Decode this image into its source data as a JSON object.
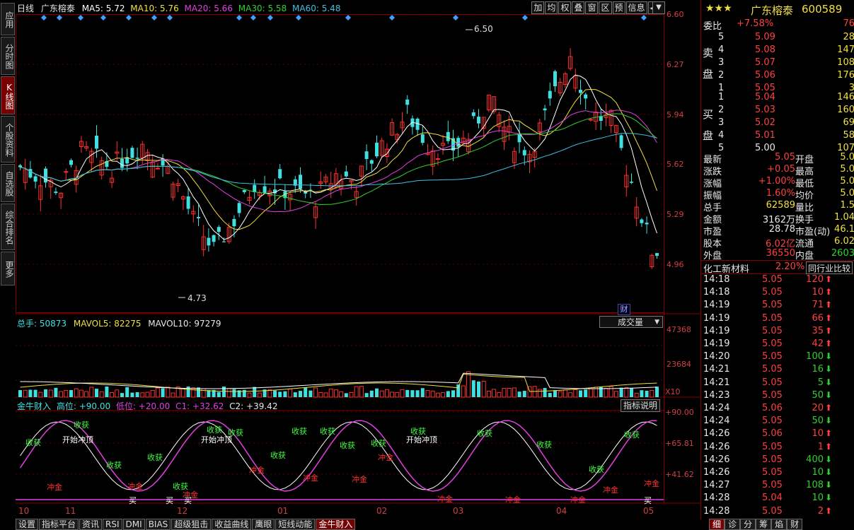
{
  "sidebar": {
    "items": [
      {
        "label": "应用",
        "active": false
      },
      {
        "label": "分时图",
        "active": false
      },
      {
        "label": "K线图",
        "active": true
      },
      {
        "label": "个股资料",
        "active": false
      },
      {
        "label": "自选股",
        "active": false
      },
      {
        "label": "综合排名",
        "active": false
      },
      {
        "label": "更多",
        "active": false
      }
    ]
  },
  "kline": {
    "period_label": "日线",
    "stock_name": "广东榕泰",
    "ma5": "MA5: 5.72",
    "ma10": "MA10: 5.76",
    "ma20": "MA20: 5.66",
    "ma30": "MA30: 5.58",
    "ma60": "MA60: 5.48",
    "price_ticks": [
      "6.60",
      "6.27",
      "5.94",
      "5.62",
      "5.29",
      "4.96"
    ],
    "high_label": "6.50",
    "low_label": "4.73",
    "fin_badge": "财",
    "colors": {
      "ma5": "#ffffff",
      "ma10": "#f0e040",
      "ma20": "#e040e0",
      "ma30": "#30d030",
      "ma60": "#40c0e0"
    }
  },
  "toolbar": {
    "buttons": [
      "加",
      "均",
      "权",
      "叠",
      "窗",
      "区",
      "预",
      "信息",
      "◀▌"
    ]
  },
  "volume": {
    "title": "总手: 50873",
    "mavol5": "MAVOL5: 82275",
    "mavol10": "MAVOL10: 97279",
    "selector": "成交量",
    "ticks": [
      "47368",
      "23684"
    ],
    "unit": "X10"
  },
  "indicator": {
    "name": "金牛财入",
    "high": "高位: +90.00",
    "low": "低位: +20.00",
    "c1": "C1: +32.62",
    "c2": "C2: +39.42",
    "help_button": "指标说明",
    "ticks": [
      "+90.00",
      "+65.81",
      "+41.62"
    ],
    "labels": {
      "harvest": "收获",
      "start_top": "开始冲顶",
      "chong": "冲金",
      "buy": "买"
    }
  },
  "x_axis": [
    "10",
    "11",
    "12",
    "01",
    "02",
    "03",
    "04",
    "05"
  ],
  "bottom_tabs": [
    "设置",
    "指标平台",
    "资讯",
    "RSI",
    "DMI",
    "BIAS",
    "超级狙击",
    "收益曲线",
    "鹰眼",
    "短线动能",
    "金牛财入"
  ],
  "bottom_active": "金牛财入",
  "quote": {
    "stock_name": "广东榕泰",
    "code": "600589",
    "weibi_label": "委比",
    "weibi_value": "+7.58%",
    "weibi_right": "76",
    "sell_side": "卖盘",
    "buy_side": "买盘",
    "sell": [
      [
        "5",
        "5.09",
        "28"
      ],
      [
        "4",
        "5.08",
        "147"
      ],
      [
        "3",
        "5.07",
        "108"
      ],
      [
        "2",
        "5.06",
        "176"
      ],
      [
        "1",
        "5.05",
        "3"
      ]
    ],
    "buy": [
      [
        "1",
        "5.04",
        "146"
      ],
      [
        "2",
        "5.03",
        "160"
      ],
      [
        "3",
        "5.02",
        "69"
      ],
      [
        "4",
        "5.01",
        "58"
      ],
      [
        "5",
        "5.00",
        "107"
      ]
    ],
    "stats": [
      [
        "最新",
        "5.05",
        "开盘",
        "5.0"
      ],
      [
        "涨跌",
        "+0.05",
        "最高",
        "5.0"
      ],
      [
        "涨幅",
        "+1.00%",
        "最低",
        "5.0"
      ],
      [
        "振幅",
        "1.60%",
        "均价",
        "5.0"
      ],
      [
        "总手",
        "62589",
        "量比",
        "1.5"
      ],
      [
        "金额",
        "3162万",
        "换手",
        "1.04"
      ],
      [
        "市盈",
        "28.78",
        "市盈(动)",
        "46.1"
      ],
      [
        "股本",
        "6.02亿",
        "流通",
        "6.02"
      ],
      [
        "外盘",
        "36550",
        "内盘",
        "2603"
      ]
    ],
    "industry": "化工新材料",
    "industry_pct": "2.20%",
    "industry_compare": "同行业比较",
    "ticks": [
      [
        "14:18",
        "5.05",
        "120",
        "up"
      ],
      [
        "14:18",
        "5.05",
        "10",
        "up"
      ],
      [
        "14:19",
        "5.05",
        "71",
        "up"
      ],
      [
        "14:19",
        "5.05",
        "66",
        "up"
      ],
      [
        "14:19",
        "5.05",
        "35",
        "up"
      ],
      [
        "14:19",
        "5.05",
        "42",
        "up"
      ],
      [
        "14:20",
        "5.05",
        "100",
        "down"
      ],
      [
        "14:21",
        "5.05",
        "16",
        "down"
      ],
      [
        "14:21",
        "5.05",
        "5",
        "down"
      ],
      [
        "14:23",
        "5.05",
        "50",
        "down"
      ],
      [
        "14:24",
        "5.06",
        "20",
        "up"
      ],
      [
        "14:24",
        "5.05",
        "50",
        "down"
      ],
      [
        "14:26",
        "5.06",
        "10",
        "up"
      ],
      [
        "14:26",
        "5.05",
        "1",
        "up"
      ],
      [
        "14:26",
        "5.05",
        "400",
        "down"
      ],
      [
        "14:26",
        "5.05",
        "10",
        "down"
      ],
      [
        "14:27",
        "5.05",
        "108",
        "down"
      ],
      [
        "14:28",
        "5.04",
        "10",
        "down"
      ],
      [
        "14:28",
        "5.05",
        "2",
        "up"
      ]
    ],
    "tabs": [
      "细",
      "诊",
      "分",
      "筹",
      "焰",
      "财"
    ],
    "active_tab": "细"
  }
}
